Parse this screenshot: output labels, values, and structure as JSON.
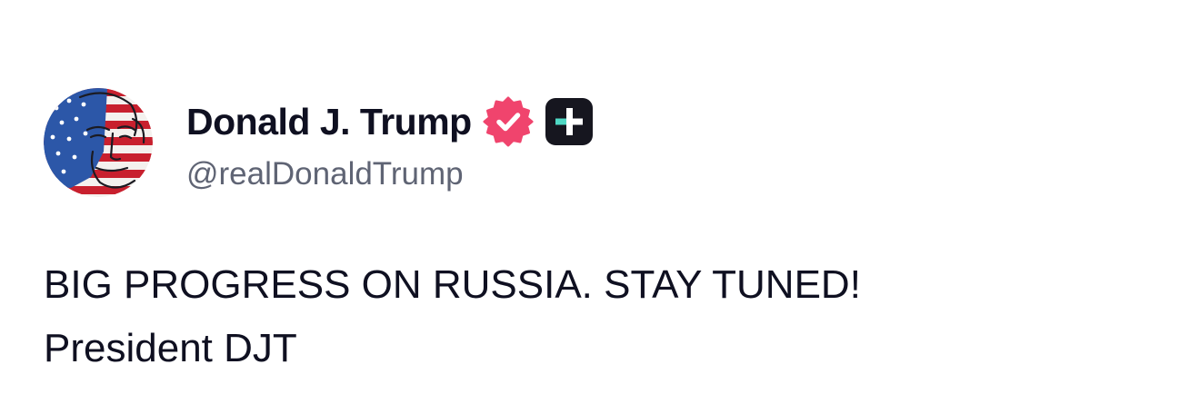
{
  "post": {
    "author": {
      "display_name": "Donald J. Trump",
      "handle": "@realDonaldTrump",
      "verified_icon": "verified-badge-icon",
      "plus_icon": "plus-badge-icon",
      "avatar_icon": "profile-avatar"
    },
    "content": {
      "line1": "BIG PROGRESS ON RUSSIA. STAY TUNED!",
      "line2": "President DJT"
    }
  },
  "colors": {
    "text": "#0f1021",
    "handle": "#5f6474",
    "verified": "#f0446d",
    "plus_badge_bg": "#16161f",
    "plus_badge_accent": "#4fd8c4",
    "background": "#ffffff"
  }
}
